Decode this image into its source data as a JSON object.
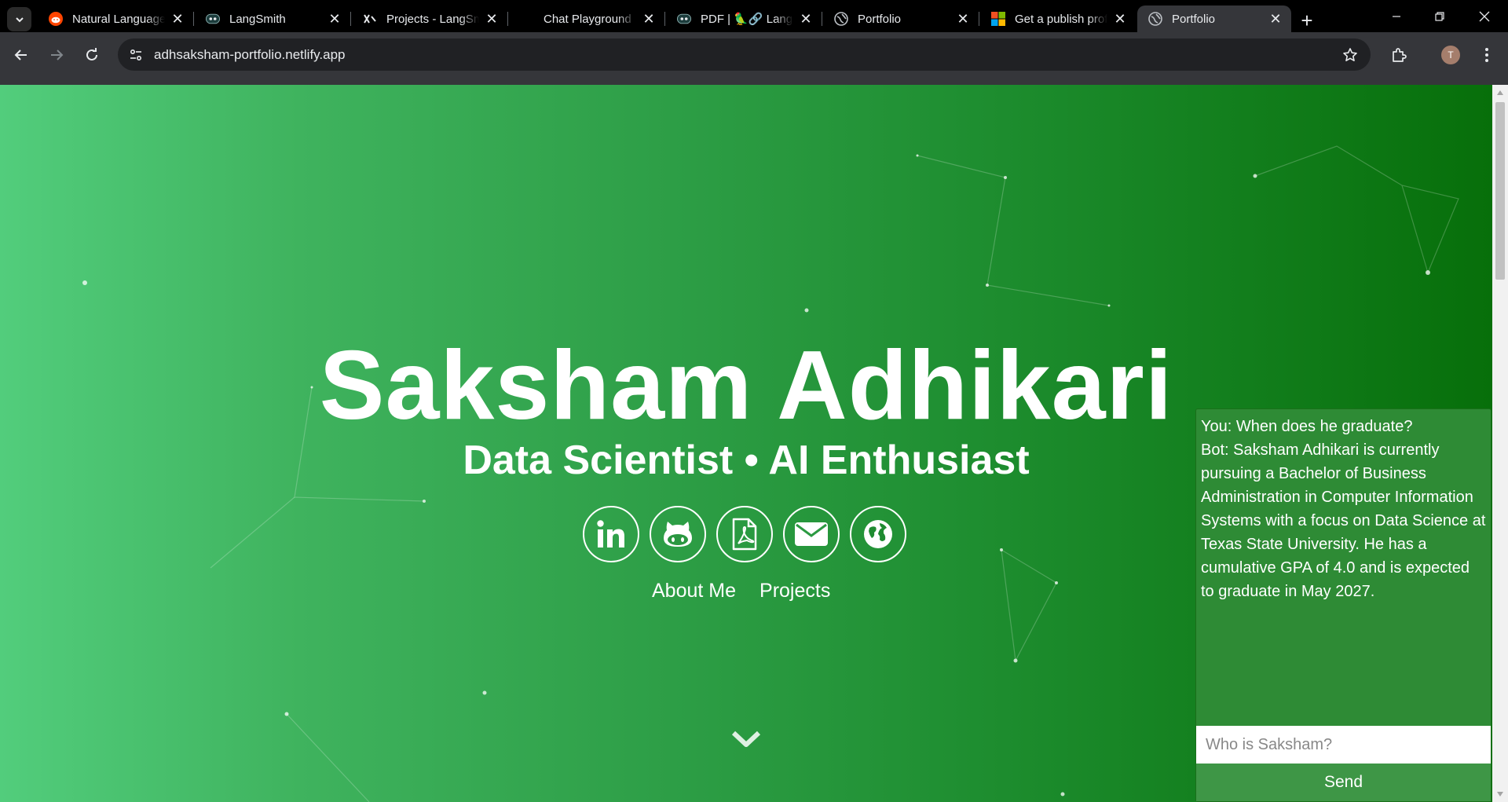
{
  "browser": {
    "tabs": [
      {
        "title": "Natural Language",
        "icon": "reddit-icon"
      },
      {
        "title": "LangSmith",
        "icon": "langsmith-icon"
      },
      {
        "title": "Projects - LangSmith",
        "icon": "langsmith-tools-icon"
      },
      {
        "title": "Chat Playground",
        "icon": "none"
      },
      {
        "title": "PDF | 🦜🔗 LangChain",
        "icon": "langsmith-icon"
      },
      {
        "title": "Portfolio",
        "icon": "globe-icon"
      },
      {
        "title": "Get a publish profile",
        "icon": "microsoft-icon"
      },
      {
        "title": "Portfolio",
        "icon": "globe-icon",
        "active": true
      }
    ],
    "url": "adhsaksham-portfolio.netlify.app",
    "profile_initial": "T"
  },
  "hero": {
    "name": "Saksham Adhikari",
    "subtitle": "Data Scientist • AI Enthusiast",
    "socials": [
      "linkedin-icon",
      "github-icon",
      "pdf-icon",
      "email-icon",
      "globe-icon"
    ],
    "links": [
      "About Me",
      "Projects"
    ]
  },
  "chat": {
    "user_message": "You: When does he graduate?",
    "bot_message": "Bot: Saksham Adhikari is currently pursuing a Bachelor of Business Administration in Computer Information Systems with a focus on Data Science at Texas State University. He has a cumulative GPA of 4.0 and is expected to graduate in May 2027.",
    "input_placeholder": "Who is Saksham?",
    "send_label": "Send"
  },
  "colors": {
    "gradient_start": "#52cd7c",
    "gradient_end": "#076f0a",
    "chat_bg": "#2e8b35",
    "send_bg": "#3e9646"
  }
}
